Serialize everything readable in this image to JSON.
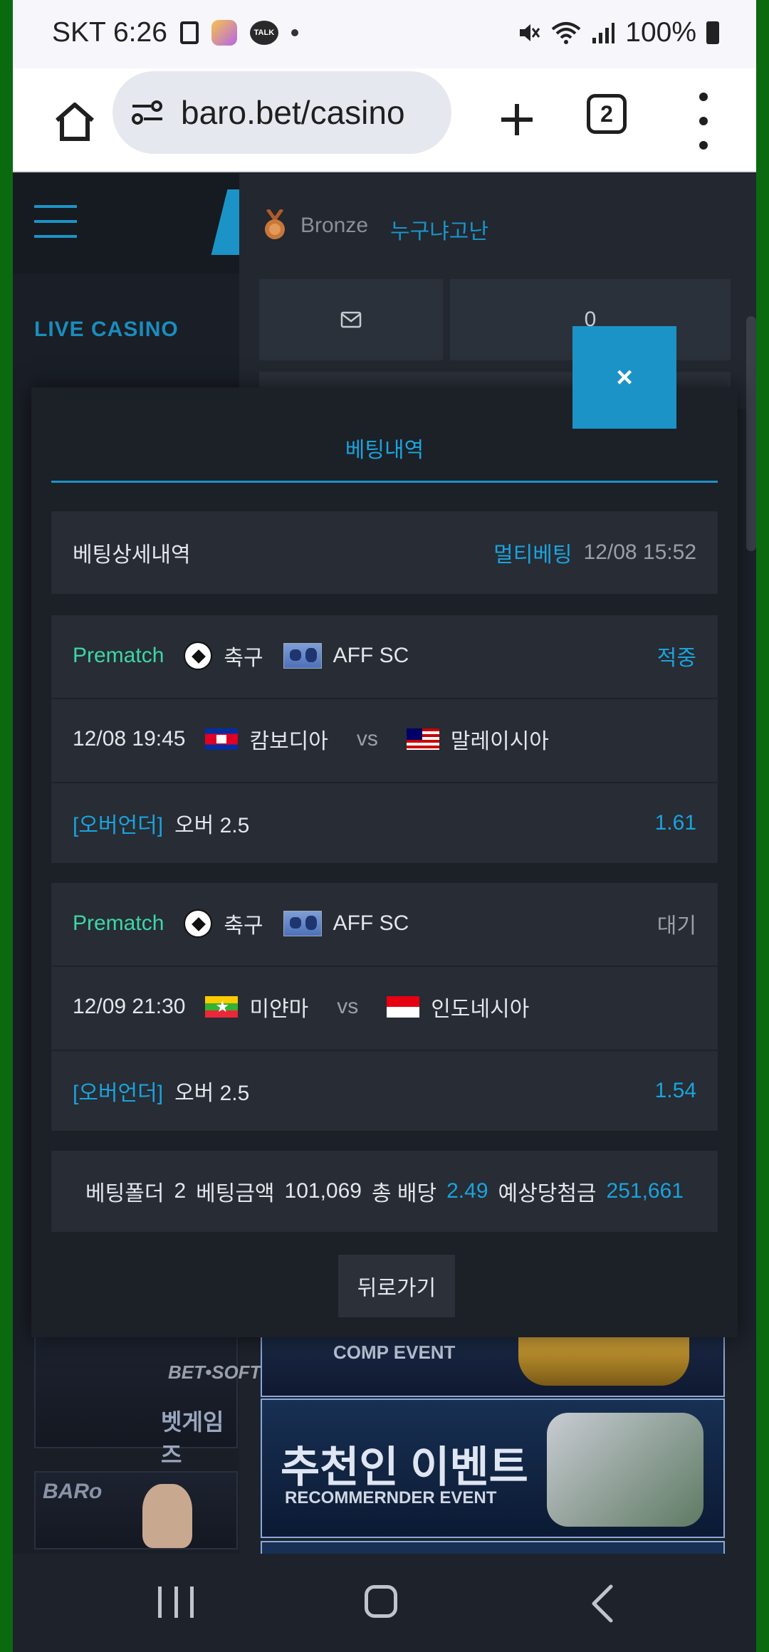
{
  "status_bar": {
    "carrier_time": "SKT 6:26",
    "talk_icon_label": "TALK",
    "battery": "100%"
  },
  "browser": {
    "url": "baro.bet/casino",
    "tab_count": "2"
  },
  "site": {
    "live_casino_label": "LIVE CASINO",
    "user_grade": "Bronze",
    "username": "누구냐고난",
    "message_count": "0",
    "banners": {
      "left1_brand": "BET•SOFT",
      "left1_title": "벳게임즈",
      "left2_brand": "BARo",
      "right1_title": "COMP EVENT",
      "right2_title": "추천인 이벤트",
      "right2_subtitle": "RECOMMERNDER EVENT"
    }
  },
  "modal": {
    "close_label": "×",
    "tab_label": "베팅내역",
    "detail": {
      "title": "베팅상세내역",
      "bet_type": "멀티베팅",
      "datetime": "12/08 15:52"
    },
    "bets": [
      {
        "category": "Prematch",
        "sport": "축구",
        "league": "AFF SC",
        "status": "적중",
        "match_time": "12/08 19:45",
        "home": "캄보디아",
        "vs": "vs",
        "away": "말레이시아",
        "market": "[오버언더]",
        "pick": "오버 2.5",
        "odds": "1.61"
      },
      {
        "category": "Prematch",
        "sport": "축구",
        "league": "AFF SC",
        "status": "대기",
        "match_time": "12/09 21:30",
        "home": "미얀마",
        "vs": "vs",
        "away": "인도네시아",
        "market": "[오버언더]",
        "pick": "오버 2.5",
        "odds": "1.54"
      }
    ],
    "summary": {
      "folder_label": "베팅폴더",
      "folder_value": "2",
      "amount_label": "베팅금액",
      "amount_value": "101,069",
      "total_odds_label": "총 배당",
      "total_odds_value": "2.49",
      "expected_label": "예상당첨금",
      "expected_value": "251,661"
    },
    "back_label": "뒤로가기"
  },
  "colors": {
    "accent": "#1b93c7",
    "mint": "#3ed6a4",
    "panel": "#272c35",
    "modal_bg": "#1c2027"
  }
}
